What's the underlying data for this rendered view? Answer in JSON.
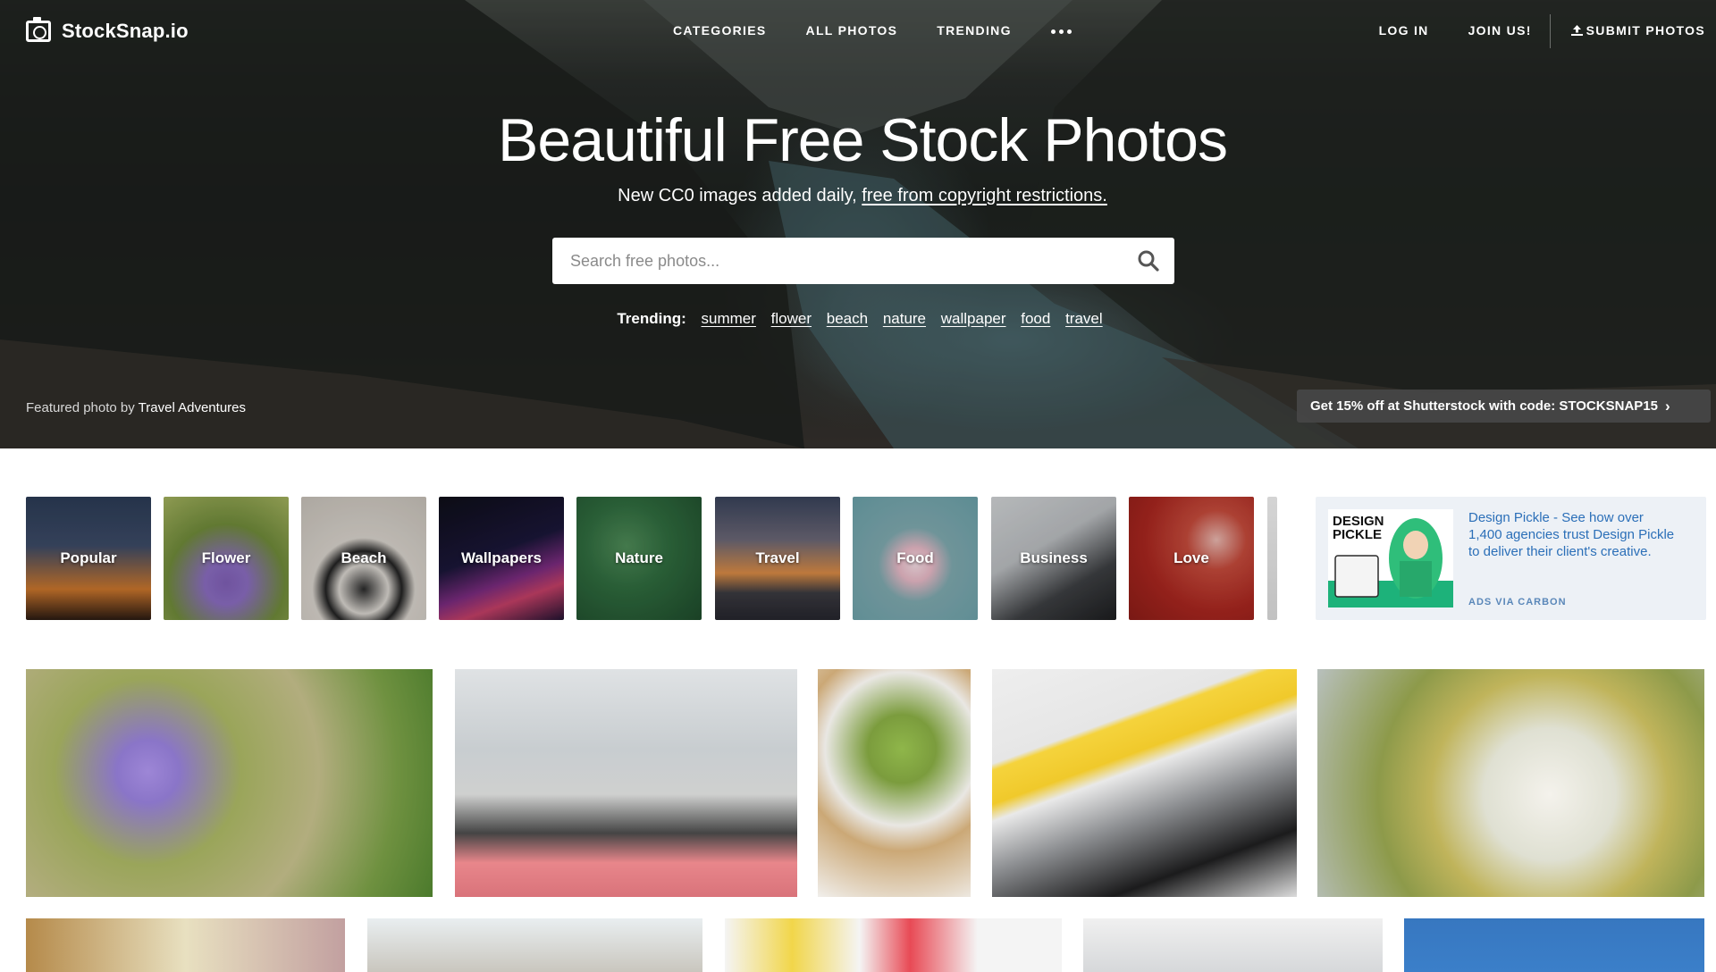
{
  "brand": {
    "name": "StockSnap.io"
  },
  "nav": {
    "center": [
      "CATEGORIES",
      "ALL PHOTOS",
      "TRENDING"
    ],
    "login": "LOG IN",
    "join": "JOIN US!",
    "submit": "SUBMIT PHOTOS"
  },
  "hero": {
    "title": "Beautiful Free Stock Photos",
    "subtitle_prefix": "New CC0 images added daily, ",
    "subtitle_link": "free from copyright restrictions.",
    "search_placeholder": "Search free photos...",
    "trending_label": "Trending:",
    "trending_terms": [
      "summer",
      "flower",
      "beach",
      "nature",
      "wallpaper",
      "food",
      "travel"
    ],
    "featured_prefix": "Featured photo by ",
    "featured_author": "Travel Adventures",
    "promo": "Get 15% off at Shutterstock with code: STOCKSNAP15"
  },
  "categories": [
    "Popular",
    "Flower",
    "Beach",
    "Wallpapers",
    "Nature",
    "Travel",
    "Food",
    "Business",
    "Love"
  ],
  "ad": {
    "image_text": "DESIGN PICKLE",
    "text": "Design Pickle - See how over 1,400 agencies trust Design Pickle to deliver their client's creative.",
    "via": "ADS VIA CARBON"
  },
  "icons": {
    "logo": "camera-icon",
    "more": "more-dots-icon",
    "upload": "upload-icon",
    "search": "search-icon",
    "promo_arrow": "chevron-right-icon"
  }
}
